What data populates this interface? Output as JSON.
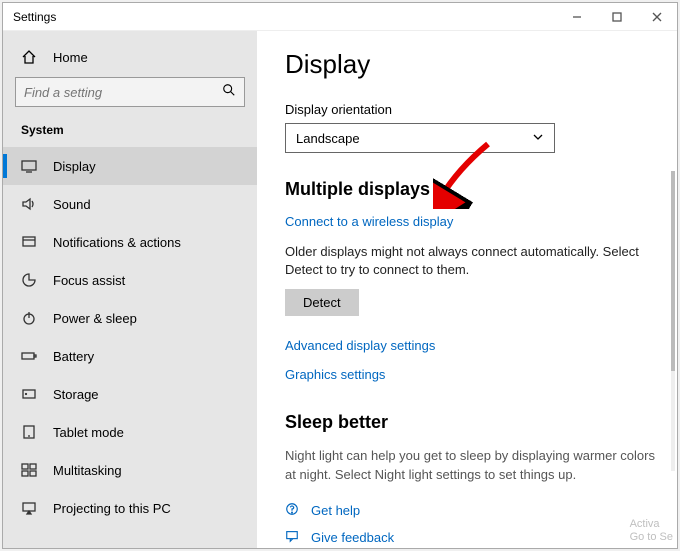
{
  "window": {
    "title": "Settings"
  },
  "sidebar": {
    "home": "Home",
    "search_placeholder": "Find a setting",
    "category": "System",
    "items": [
      {
        "label": "Display"
      },
      {
        "label": "Sound"
      },
      {
        "label": "Notifications & actions"
      },
      {
        "label": "Focus assist"
      },
      {
        "label": "Power & sleep"
      },
      {
        "label": "Battery"
      },
      {
        "label": "Storage"
      },
      {
        "label": "Tablet mode"
      },
      {
        "label": "Multitasking"
      },
      {
        "label": "Projecting to this PC"
      }
    ]
  },
  "main": {
    "title": "Display",
    "orientation_label": "Display orientation",
    "orientation_value": "Landscape",
    "multiple_title": "Multiple displays",
    "connect_link": "Connect to a wireless display",
    "older_desc": "Older displays might not always connect automatically. Select Detect to try to connect to them.",
    "detect_btn": "Detect",
    "advanced_link": "Advanced display settings",
    "graphics_link": "Graphics settings",
    "sleep_title": "Sleep better",
    "sleep_desc": "Night light can help you get to sleep by displaying warmer colors at night. Select Night light settings to set things up.",
    "get_help": "Get help",
    "give_feedback": "Give feedback"
  },
  "watermark": {
    "line1": "Activa",
    "line2": "Go to Se"
  }
}
